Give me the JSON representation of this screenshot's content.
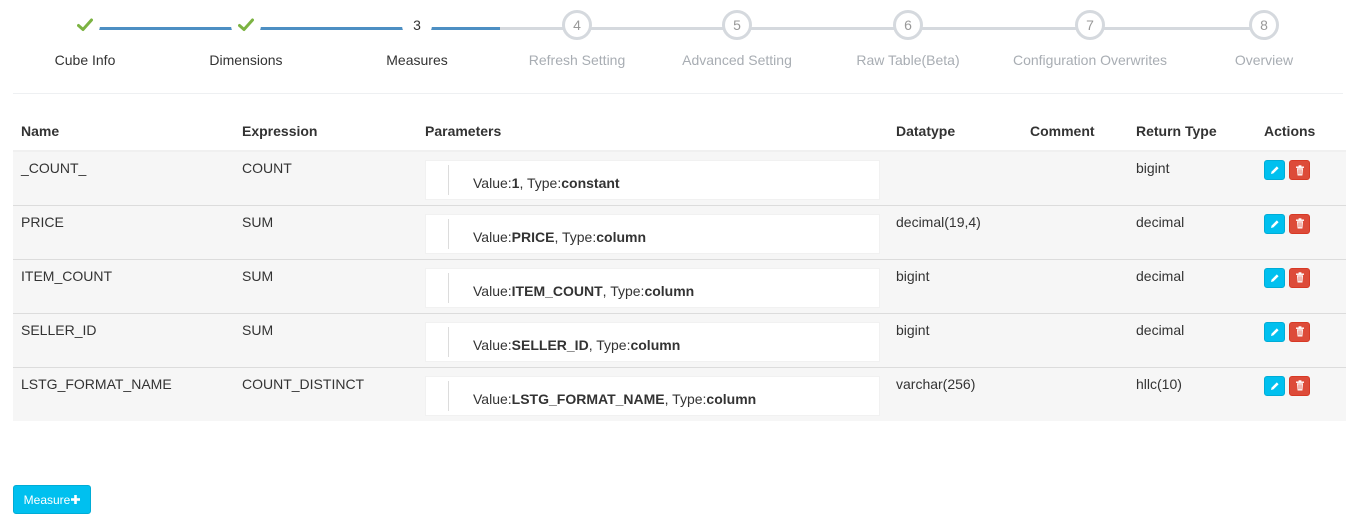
{
  "wizard": {
    "steps": [
      {
        "number": "1",
        "label": "Cube Info",
        "state": "done"
      },
      {
        "number": "2",
        "label": "Dimensions",
        "state": "done"
      },
      {
        "number": "3",
        "label": "Measures",
        "state": "active"
      },
      {
        "number": "4",
        "label": "Refresh Setting",
        "state": "todo"
      },
      {
        "number": "5",
        "label": "Advanced Setting",
        "state": "todo"
      },
      {
        "number": "6",
        "label": "Raw Table(Beta)",
        "state": "todo"
      },
      {
        "number": "7",
        "label": "Configuration Overwrites",
        "state": "todo"
      },
      {
        "number": "8",
        "label": "Overview",
        "state": "todo"
      }
    ]
  },
  "table": {
    "headers": {
      "name": "Name",
      "expression": "Expression",
      "parameters": "Parameters",
      "datatype": "Datatype",
      "comment": "Comment",
      "return_type": "Return Type",
      "actions": "Actions"
    },
    "param_prefix": {
      "value": "Value:",
      "type": ", Type:"
    },
    "rows": [
      {
        "name": "_COUNT_",
        "expression": "COUNT",
        "param_value": "1",
        "param_type": "constant",
        "datatype": "",
        "comment": "",
        "return_type": "bigint"
      },
      {
        "name": "PRICE",
        "expression": "SUM",
        "param_value": "PRICE",
        "param_type": "column",
        "datatype": "decimal(19,4)",
        "comment": "",
        "return_type": "decimal"
      },
      {
        "name": "ITEM_COUNT",
        "expression": "SUM",
        "param_value": "ITEM_COUNT",
        "param_type": "column",
        "datatype": "bigint",
        "comment": "",
        "return_type": "decimal"
      },
      {
        "name": "SELLER_ID",
        "expression": "SUM",
        "param_value": "SELLER_ID",
        "param_type": "column",
        "datatype": "bigint",
        "comment": "",
        "return_type": "decimal"
      },
      {
        "name": "LSTG_FORMAT_NAME",
        "expression": "COUNT_DISTINCT",
        "param_value": "LSTG_FORMAT_NAME",
        "param_type": "column",
        "datatype": "varchar(256)",
        "comment": "",
        "return_type": "hllc(10)"
      }
    ]
  },
  "add_measure_label": "Measure",
  "icons": {
    "done": "check-icon",
    "edit": "pencil-icon",
    "delete": "trash-icon",
    "add": "plus-icon"
  },
  "colors": {
    "accent": "#4d8fc3",
    "check": "#7cb342",
    "inactive": "#d5d9de",
    "edit_button": "#00c0ef",
    "delete_button": "#dd4b39"
  }
}
